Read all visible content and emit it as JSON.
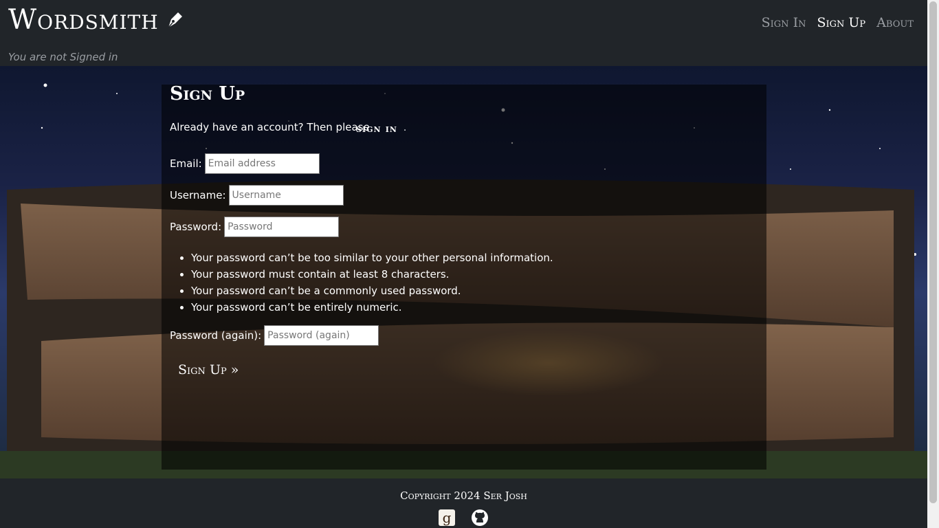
{
  "header": {
    "brand": "Wordsmith",
    "nav": [
      {
        "label": "Sign In",
        "active": false
      },
      {
        "label": "Sign Up",
        "active": true
      },
      {
        "label": "About",
        "active": false
      }
    ],
    "status": "You are not Signed in"
  },
  "form": {
    "title": "Sign Up",
    "already_text": "Already have an account? Then please",
    "signin_link": "sign in",
    "trailing_dot": ".",
    "email_label": "Email:",
    "email_placeholder": "Email address",
    "username_label": "Username:",
    "username_placeholder": "Username",
    "password_label": "Password:",
    "password_placeholder": "Password",
    "rules": [
      "Your password can’t be too similar to your other personal information.",
      "Your password must contain at least 8 characters.",
      "Your password can’t be a commonly used password.",
      "Your password can’t be entirely numeric."
    ],
    "password2_label": "Password (again):",
    "password2_placeholder": "Password (again)",
    "submit_label": "Sign Up »"
  },
  "footer": {
    "copyright": "Copyright 2024 Ser Josh",
    "icons": [
      "goodreads-icon",
      "github-icon"
    ]
  },
  "colors": {
    "background": "#212529",
    "muted_text": "#9a9ea3"
  }
}
